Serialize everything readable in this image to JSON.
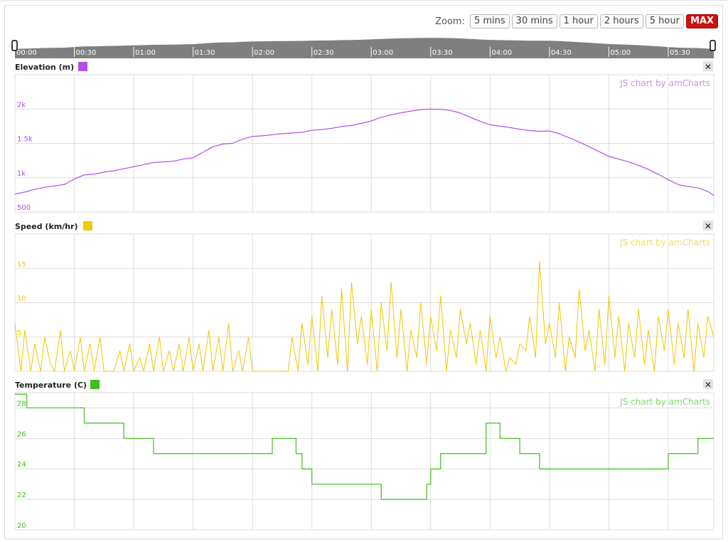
{
  "zoom": {
    "label": "Zoom:",
    "buttons": [
      "5 mins",
      "30 mins",
      "1 hour",
      "2 hours",
      "5 hour",
      "MAX"
    ],
    "active": "MAX"
  },
  "colors": {
    "elevation": "#b04fe6",
    "speed": "#f0c800",
    "temperature": "#3fbf1c",
    "navigator": "#7f7f7f",
    "grid": "#dddddd"
  },
  "navigator_ticks": [
    "00:00",
    "00:30",
    "01:00",
    "01:30",
    "02:00",
    "02:30",
    "03:00",
    "03:30",
    "04:00",
    "04:30",
    "05:00",
    "05:30"
  ],
  "credit": "JS chart by amCharts",
  "close_glyph": "✕",
  "chart_data": [
    {
      "type": "line",
      "title": "Elevation (m)",
      "x_unit": "minutes",
      "xlim": [
        0,
        353
      ],
      "ylim": [
        500,
        2500
      ],
      "yticks": [
        {
          "v": 500,
          "label": "500"
        },
        {
          "v": 1000,
          "label": "1k"
        },
        {
          "v": 1500,
          "label": "1.5k"
        },
        {
          "v": 2000,
          "label": "2k"
        }
      ],
      "x": [
        0,
        5,
        10,
        15,
        20,
        25,
        30,
        35,
        40,
        45,
        50,
        55,
        60,
        65,
        70,
        75,
        80,
        85,
        90,
        95,
        100,
        105,
        110,
        115,
        120,
        125,
        130,
        135,
        140,
        145,
        150,
        155,
        160,
        165,
        170,
        175,
        180,
        185,
        190,
        195,
        200,
        205,
        210,
        215,
        220,
        225,
        230,
        235,
        240,
        245,
        250,
        255,
        260,
        265,
        270,
        275,
        280,
        285,
        290,
        295,
        300,
        305,
        310,
        315,
        320,
        325,
        330,
        335,
        340,
        345,
        350,
        353
      ],
      "y": [
        760,
        790,
        830,
        860,
        880,
        900,
        980,
        1040,
        1050,
        1080,
        1100,
        1130,
        1160,
        1190,
        1220,
        1230,
        1240,
        1270,
        1290,
        1370,
        1450,
        1490,
        1500,
        1560,
        1600,
        1610,
        1625,
        1640,
        1650,
        1660,
        1690,
        1700,
        1720,
        1745,
        1760,
        1790,
        1825,
        1880,
        1915,
        1945,
        1970,
        1990,
        2000,
        1995,
        1980,
        1940,
        1880,
        1820,
        1770,
        1750,
        1730,
        1705,
        1685,
        1675,
        1680,
        1640,
        1580,
        1520,
        1450,
        1380,
        1310,
        1270,
        1230,
        1180,
        1120,
        1050,
        970,
        900,
        870,
        850,
        800,
        740
      ]
    },
    {
      "type": "line",
      "title": "Speed (km/hr)",
      "x_unit": "minutes",
      "xlim": [
        0,
        353
      ],
      "ylim": [
        0,
        20
      ],
      "yticks": [
        {
          "v": 5,
          "label": "5"
        },
        {
          "v": 10,
          "label": "10"
        },
        {
          "v": 15,
          "label": "15"
        }
      ],
      "x": [
        0,
        3,
        5,
        8,
        10,
        13,
        15,
        18,
        20,
        23,
        25,
        28,
        30,
        33,
        35,
        38,
        40,
        43,
        45,
        48,
        50,
        53,
        55,
        58,
        60,
        63,
        65,
        68,
        70,
        73,
        75,
        78,
        80,
        83,
        85,
        88,
        90,
        93,
        95,
        98,
        100,
        103,
        105,
        108,
        110,
        113,
        115,
        118,
        120,
        123,
        125,
        128,
        130,
        133,
        135,
        138,
        140,
        143,
        145,
        148,
        150,
        153,
        155,
        158,
        160,
        163,
        165,
        168,
        170,
        173,
        175,
        178,
        180,
        183,
        185,
        188,
        190,
        193,
        195,
        198,
        200,
        203,
        205,
        208,
        210,
        213,
        215,
        218,
        220,
        223,
        225,
        228,
        230,
        233,
        235,
        238,
        240,
        243,
        245,
        248,
        250,
        253,
        255,
        258,
        260,
        263,
        265,
        268,
        270,
        273,
        275,
        278,
        280,
        283,
        285,
        288,
        290,
        293,
        295,
        298,
        300,
        303,
        305,
        308,
        310,
        313,
        315,
        318,
        320,
        323,
        325,
        328,
        330,
        333,
        335,
        338,
        340,
        343,
        345,
        348,
        350,
        353
      ],
      "y": [
        7,
        0,
        6,
        0,
        4,
        0,
        5,
        1,
        0,
        6,
        0,
        3,
        0,
        5,
        0,
        4,
        0,
        5,
        0,
        0,
        0,
        3,
        0,
        4,
        0,
        2,
        0,
        4,
        0,
        5,
        0,
        3,
        0,
        4,
        0,
        5,
        0,
        4,
        0,
        6,
        0,
        5,
        0,
        7,
        0,
        3,
        0,
        5,
        0,
        0,
        0,
        0,
        0,
        0,
        0,
        0,
        5,
        0,
        7,
        1,
        8,
        0,
        11,
        2,
        9,
        1,
        12,
        0,
        13,
        4,
        8,
        1,
        9,
        0,
        10,
        3,
        13,
        2,
        9,
        0,
        6,
        2,
        10,
        1,
        8,
        3,
        11,
        0,
        6,
        2,
        9,
        4,
        7,
        1,
        6,
        0,
        8,
        2,
        5,
        0,
        2,
        1,
        4,
        3,
        8,
        2,
        16,
        4,
        7,
        2,
        10,
        0,
        5,
        2,
        12,
        3,
        6,
        0,
        9,
        1,
        11,
        2,
        8,
        0,
        7,
        2,
        9,
        1,
        6,
        0,
        8,
        3,
        9,
        1,
        7,
        2,
        9,
        0,
        7,
        2,
        8,
        5
      ]
    },
    {
      "type": "line",
      "title": "Temperature (C)",
      "x_unit": "minutes",
      "xlim": [
        0,
        353
      ],
      "ylim": [
        20,
        29
      ],
      "yticks": [
        {
          "v": 20,
          "label": "20"
        },
        {
          "v": 22,
          "label": "22"
        },
        {
          "v": 24,
          "label": "24"
        },
        {
          "v": 26,
          "label": "26"
        },
        {
          "v": 28,
          "label": "28"
        }
      ],
      "x": [
        0,
        5,
        6,
        22,
        30,
        35,
        40,
        55,
        70,
        80,
        95,
        105,
        120,
        130,
        138,
        142,
        145,
        150,
        158,
        175,
        182,
        185,
        190,
        198,
        208,
        210,
        215,
        230,
        238,
        245,
        250,
        255,
        265,
        270,
        280,
        290,
        295,
        305,
        315,
        330,
        340,
        345,
        350,
        353
      ],
      "y": [
        28.9,
        28.9,
        28,
        28,
        28,
        27,
        27,
        26,
        25,
        25,
        25,
        25,
        25,
        26,
        26,
        25,
        24,
        23,
        23,
        23,
        23,
        22,
        22,
        22,
        23,
        24,
        25,
        25,
        27,
        26,
        26,
        25,
        24,
        24,
        24,
        24,
        24,
        24,
        24,
        25,
        25,
        26,
        26,
        26
      ]
    }
  ]
}
